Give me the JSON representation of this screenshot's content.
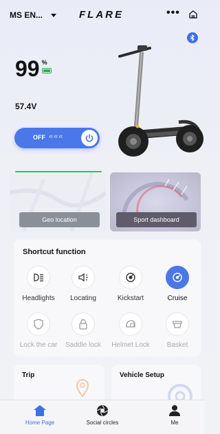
{
  "header": {
    "device_name": "MS EN...",
    "brand": "FLARE",
    "more": "•••"
  },
  "status": {
    "battery_value": "99",
    "battery_unit": "%",
    "voltage": "57.4V"
  },
  "power": {
    "state_label": "OFF",
    "chevrons": "« « «"
  },
  "cards": {
    "geo_location": "Geo location",
    "sport_dashboard": "Sport dashboard"
  },
  "shortcut": {
    "title": "Shortcut function",
    "items": [
      {
        "label": "Headlights",
        "icon": "headlight-icon",
        "active": false,
        "enabled": true
      },
      {
        "label": "Locating",
        "icon": "speaker-icon",
        "active": false,
        "enabled": true
      },
      {
        "label": "Kickstart",
        "icon": "kickstart-icon",
        "active": false,
        "enabled": true
      },
      {
        "label": "Cruise",
        "icon": "cruise-icon",
        "active": true,
        "enabled": true
      },
      {
        "label": "Lock the car",
        "icon": "shield-icon",
        "active": false,
        "enabled": false
      },
      {
        "label": "Saddle lock",
        "icon": "lock-icon",
        "active": false,
        "enabled": false
      },
      {
        "label": "Helmet Lock",
        "icon": "helmet-icon",
        "active": false,
        "enabled": false
      },
      {
        "label": "Basket",
        "icon": "basket-icon",
        "active": false,
        "enabled": false
      }
    ]
  },
  "trip": {
    "title": "Trip"
  },
  "vehicle_setup": {
    "title": "Vehicle Setup"
  },
  "nav": {
    "items": [
      {
        "label": "Home Page",
        "icon": "home-icon",
        "active": true
      },
      {
        "label": "Social circles",
        "icon": "aperture-icon",
        "active": false
      },
      {
        "label": "Me",
        "icon": "person-icon",
        "active": false
      }
    ]
  },
  "colors": {
    "accent": "#4a78e8",
    "battery_green": "#2fb04a",
    "progress_green": "#35c24c"
  }
}
